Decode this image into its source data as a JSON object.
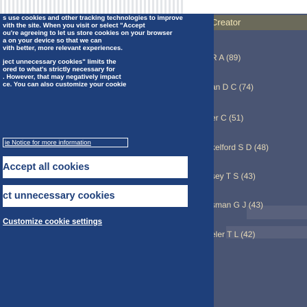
{
  "background": {
    "list_items": [
      "Creator",
      "R A (89)",
      "an D C (74)",
      "er C (51)",
      "kelford S D (48)",
      "sey T S (43)",
      "sman G J (43)",
      "eler T L (42)"
    ]
  },
  "modal": {
    "paragraph1": [
      "s use cookies and other tracking technologies to improve",
      "vith the site. When you visit or select \"Accept",
      "ou're agreeing to let us store cookies on your browser",
      "a on your device so that we can",
      "vith better, more relevant experiences."
    ],
    "paragraph2": [
      "ject unnecessary cookies\" limits the",
      "ored to what's strictly necessary for",
      ". However, that may negatively impact",
      "ce. You can also customize your cookie"
    ],
    "notice_link": "ie Notice for more information",
    "accept_button": "Accept all cookies",
    "reject_button": "ct unnecessary cookies",
    "customize_link": "Customize cookie settings"
  },
  "colors": {
    "modal_bg": "#1e3f7a",
    "button_bg": "#ffffff",
    "button_text": "#1e3f7a",
    "list_text": "#e6d9b8"
  }
}
